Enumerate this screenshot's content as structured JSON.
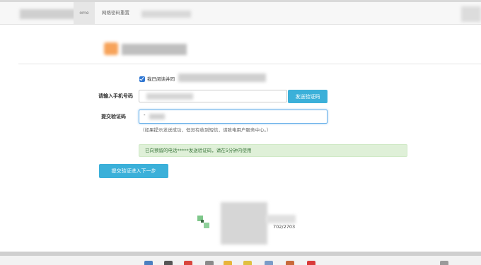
{
  "nav": {
    "home_label": "ome",
    "reset_label": "网络密码重置"
  },
  "form": {
    "agree_text": "我已阅读并同",
    "phone_label": "请输入手机号码",
    "send_code_button": "发送验证码",
    "code_label": "提交验证码",
    "code_caret": "-",
    "help_text": "（如果提示发送成功，但没有收到短信，请致电用户服务中心。）",
    "alert_text": "已向预留的电话*****发送验证码，请在5分钟内使用",
    "submit_button": "提交验证进入下一步",
    "agree_checked": true
  },
  "footer": {
    "counter": "702/2703"
  },
  "colors": {
    "primary_button": "#3bb0d9",
    "alert_bg": "#dff0d8",
    "alert_text": "#3c763d",
    "brand_orange": "#f7a35a"
  },
  "taskbar_icons": [
    "monitor-icon",
    "mic-icon",
    "browser-icon",
    "note-icon",
    "folder-icon",
    "star-icon",
    "grid-icon",
    "app-icon",
    "app-icon",
    "app-icon"
  ]
}
